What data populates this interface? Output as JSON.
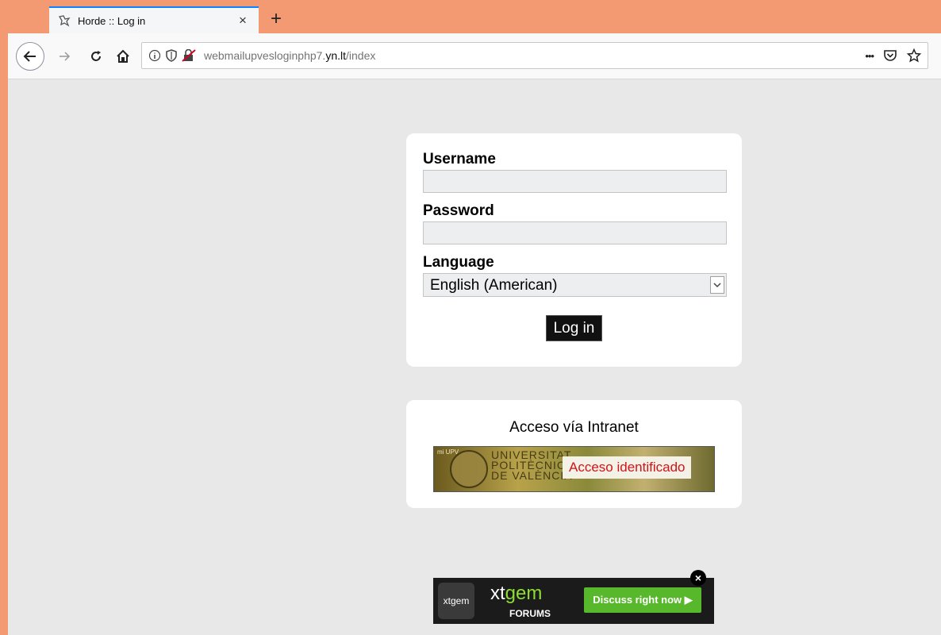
{
  "browser": {
    "tab_title": "Horde :: Log in",
    "tab_close": "×",
    "new_tab": "+",
    "url_path_prefix": "webmailupvesloginphp7.",
    "url_domain": "yn.lt",
    "url_path_suffix": "/index",
    "more_actions": "•••",
    "icons": [
      "back-icon",
      "forward-icon",
      "reload-icon",
      "home-icon",
      "info-icon",
      "shield-icon",
      "insecure-lock-icon",
      "pocket-icon",
      "star-icon"
    ]
  },
  "login": {
    "username_label": "Username",
    "username_value": "",
    "password_label": "Password",
    "password_value": "",
    "language_label": "Language",
    "language_value": "English (American)",
    "submit_label": "Log in"
  },
  "intranet": {
    "title": "Acceso vía Intranet",
    "banner_small": "mi UPV",
    "banner_university": "UNIVERSITAT\nPOLITÈCNICA\nDE VALÈNCIA",
    "banner_cta": "Acceso identificado"
  },
  "ad": {
    "logo_text": "xtgem",
    "brand_prefix": "xt",
    "brand_highlight": "gem",
    "forums": "FORUMS",
    "cta": "Discuss right now ▶",
    "close": "×"
  },
  "colors": {
    "titlebar": "#f39a72",
    "page_bg": "#e8e8e8",
    "accent_tab": "#0a84ff",
    "cta_red": "#d0141a",
    "ad_green": "#58b82c"
  }
}
